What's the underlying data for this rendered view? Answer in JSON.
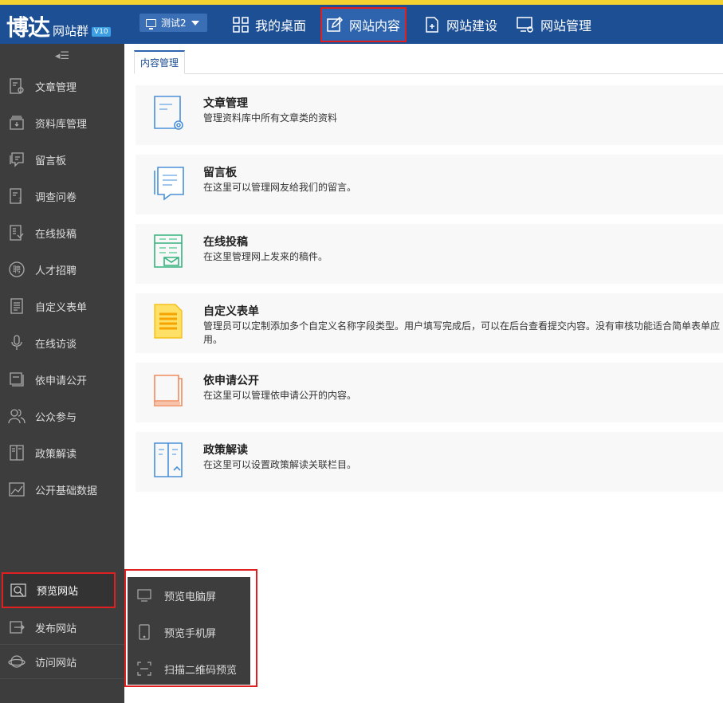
{
  "header": {
    "logo_main": "博达",
    "logo_sub": "网站群",
    "logo_version": "V10",
    "site_selector": "测试2",
    "tabs": [
      {
        "label": "我的桌面",
        "icon": "grid-icon"
      },
      {
        "label": "网站内容",
        "icon": "edit-icon",
        "active": true
      },
      {
        "label": "网站建设",
        "icon": "add-page-icon"
      },
      {
        "label": "网站管理",
        "icon": "monitor-settings-icon"
      }
    ]
  },
  "sidebar": {
    "collapse_icon": "collapse-menu-icon",
    "items": [
      {
        "label": "文章管理",
        "icon": "article-icon"
      },
      {
        "label": "资料库管理",
        "icon": "archive-icon"
      },
      {
        "label": "留言板",
        "icon": "message-icon"
      },
      {
        "label": "调查问卷",
        "icon": "survey-icon"
      },
      {
        "label": "在线投稿",
        "icon": "submission-icon"
      },
      {
        "label": "人才招聘",
        "icon": "recruit-icon"
      },
      {
        "label": "自定义表单",
        "icon": "form-icon"
      },
      {
        "label": "在线访谈",
        "icon": "microphone-icon"
      },
      {
        "label": "依申请公开",
        "icon": "disclosure-icon"
      },
      {
        "label": "公众参与",
        "icon": "people-icon"
      },
      {
        "label": "政策解读",
        "icon": "policy-icon"
      },
      {
        "label": "公开基础数据",
        "icon": "data-chart-icon"
      }
    ],
    "preview": {
      "label": "预览网站",
      "icon": "preview-icon"
    },
    "lower_items": [
      {
        "label": "发布网站",
        "icon": "publish-icon"
      },
      {
        "label": "访问网站",
        "icon": "planet-icon"
      }
    ]
  },
  "main": {
    "tab_label": "内容管理",
    "cards": [
      {
        "title": "文章管理",
        "desc": "管理资料库中所有文章类的资料"
      },
      {
        "title": "留言板",
        "desc": "在这里可以管理网友给我们的留言。"
      },
      {
        "title": "在线投稿",
        "desc": "在这里管理网上发来的稿件。"
      },
      {
        "title": "自定义表单",
        "desc": "管理员可以定制添加多个自定义名称字段类型。用户填写完成后，可以在后台查看提交内容。没有审核功能适合简单表单应用。"
      },
      {
        "title": "依申请公开",
        "desc": "在这里可以管理依申请公开的内容。"
      },
      {
        "title": "政策解读",
        "desc": "在这里可以设置政策解读关联栏目。"
      }
    ]
  },
  "preview_menu": {
    "items": [
      {
        "label": "预览电脑屏",
        "icon": "desktop-icon"
      },
      {
        "label": "预览手机屏",
        "icon": "mobile-icon"
      },
      {
        "label": "扫描二维码预览",
        "icon": "qr-scan-icon"
      }
    ]
  },
  "colors": {
    "header_bg": "#1c4f94",
    "header_top_stripe": "#f4d22f",
    "sidebar_bg": "#3d3d3d",
    "highlight_outline": "#e02020",
    "card_bg": "#f8f8f8"
  }
}
